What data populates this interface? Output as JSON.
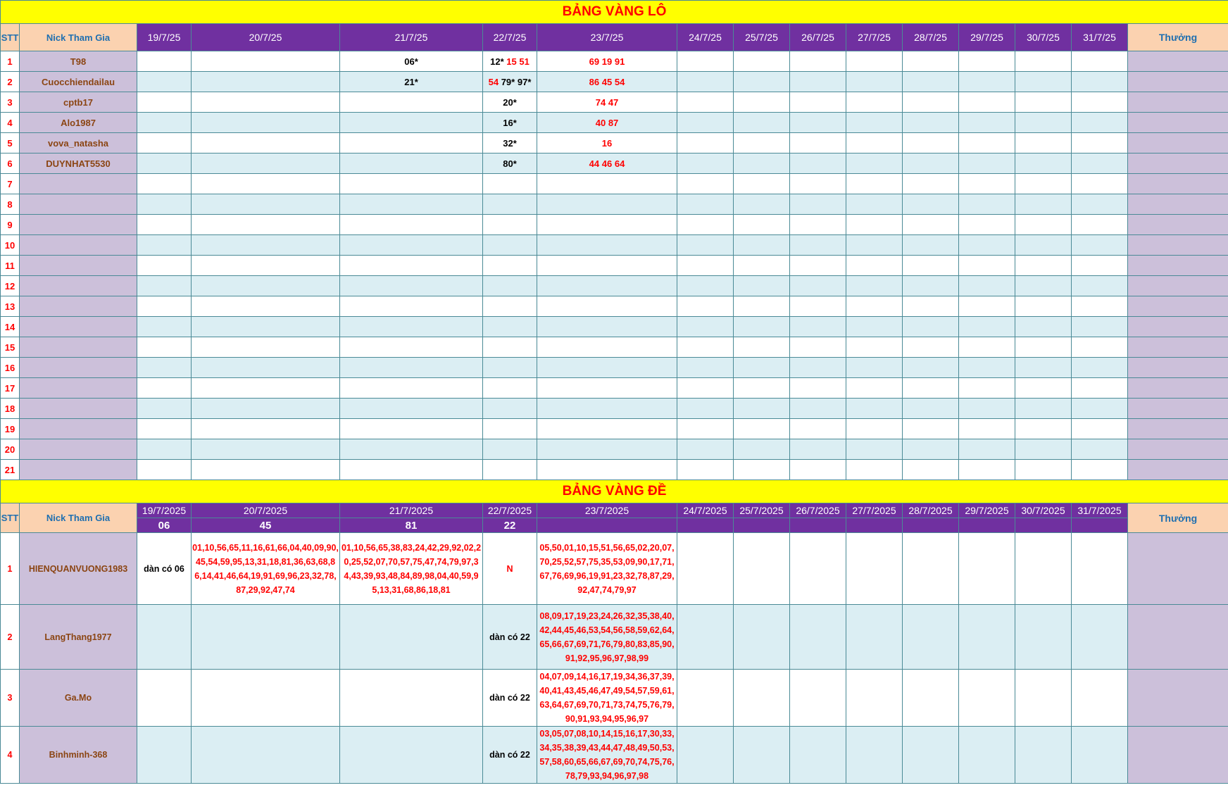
{
  "lo": {
    "title": "BẢNG VÀNG LÔ",
    "headers": {
      "stt": "STT",
      "nick": "Nick Tham Gia",
      "prize": "Thưởng"
    },
    "dates": [
      "19/7/25",
      "20/7/25",
      "21/7/25",
      "22/7/25",
      "23/7/25",
      "24/7/25",
      "25/7/25",
      "26/7/25",
      "27/7/25",
      "28/7/25",
      "29/7/25",
      "30/7/25",
      "31/7/25"
    ],
    "rows": [
      {
        "n": "1",
        "nick": "T98",
        "cells": [
          "",
          "",
          "06*",
          "12* |15 51",
          "69 19 91",
          "",
          "",
          "",
          "",
          "",
          "",
          "",
          ""
        ]
      },
      {
        "n": "2",
        "nick": "Cuocchiendailau",
        "cells": [
          "",
          "",
          "21*",
          "54| 79* 97*",
          "86 45 54",
          "",
          "",
          "",
          "",
          "",
          "",
          "",
          ""
        ]
      },
      {
        "n": "3",
        "nick": "cptb17",
        "cells": [
          "",
          "",
          "",
          "20*",
          "74 47",
          "",
          "",
          "",
          "",
          "",
          "",
          "",
          ""
        ]
      },
      {
        "n": "4",
        "nick": "Alo1987",
        "cells": [
          "",
          "",
          "",
          "16*",
          "40 87",
          "",
          "",
          "",
          "",
          "",
          "",
          "",
          ""
        ]
      },
      {
        "n": "5",
        "nick": "vova_natasha",
        "cells": [
          "",
          "",
          "",
          "32*",
          "16",
          "",
          "",
          "",
          "",
          "",
          "",
          "",
          ""
        ]
      },
      {
        "n": "6",
        "nick": "DUYNHAT5530",
        "cells": [
          "",
          "",
          "",
          "80*",
          "44 46 64",
          "",
          "",
          "",
          "",
          "",
          "",
          "",
          ""
        ]
      },
      {
        "n": "7",
        "nick": "",
        "cells": [
          "",
          "",
          "",
          "",
          "",
          "",
          "",
          "",
          "",
          "",
          "",
          "",
          ""
        ]
      },
      {
        "n": "8",
        "nick": "",
        "cells": [
          "",
          "",
          "",
          "",
          "",
          "",
          "",
          "",
          "",
          "",
          "",
          "",
          ""
        ]
      },
      {
        "n": "9",
        "nick": "",
        "cells": [
          "",
          "",
          "",
          "",
          "",
          "",
          "",
          "",
          "",
          "",
          "",
          "",
          ""
        ]
      },
      {
        "n": "10",
        "nick": "",
        "cells": [
          "",
          "",
          "",
          "",
          "",
          "",
          "",
          "",
          "",
          "",
          "",
          "",
          ""
        ]
      },
      {
        "n": "11",
        "nick": "",
        "cells": [
          "",
          "",
          "",
          "",
          "",
          "",
          "",
          "",
          "",
          "",
          "",
          "",
          ""
        ]
      },
      {
        "n": "12",
        "nick": "",
        "cells": [
          "",
          "",
          "",
          "",
          "",
          "",
          "",
          "",
          "",
          "",
          "",
          "",
          ""
        ]
      },
      {
        "n": "13",
        "nick": "",
        "cells": [
          "",
          "",
          "",
          "",
          "",
          "",
          "",
          "",
          "",
          "",
          "",
          "",
          ""
        ]
      },
      {
        "n": "14",
        "nick": "",
        "cells": [
          "",
          "",
          "",
          "",
          "",
          "",
          "",
          "",
          "",
          "",
          "",
          "",
          ""
        ]
      },
      {
        "n": "15",
        "nick": "",
        "cells": [
          "",
          "",
          "",
          "",
          "",
          "",
          "",
          "",
          "",
          "",
          "",
          "",
          ""
        ]
      },
      {
        "n": "16",
        "nick": "",
        "cells": [
          "",
          "",
          "",
          "",
          "",
          "",
          "",
          "",
          "",
          "",
          "",
          "",
          ""
        ]
      },
      {
        "n": "17",
        "nick": "",
        "cells": [
          "",
          "",
          "",
          "",
          "",
          "",
          "",
          "",
          "",
          "",
          "",
          "",
          ""
        ]
      },
      {
        "n": "18",
        "nick": "",
        "cells": [
          "",
          "",
          "",
          "",
          "",
          "",
          "",
          "",
          "",
          "",
          "",
          "",
          ""
        ]
      },
      {
        "n": "19",
        "nick": "",
        "cells": [
          "",
          "",
          "",
          "",
          "",
          "",
          "",
          "",
          "",
          "",
          "",
          "",
          ""
        ]
      },
      {
        "n": "20",
        "nick": "",
        "cells": [
          "",
          "",
          "",
          "",
          "",
          "",
          "",
          "",
          "",
          "",
          "",
          "",
          ""
        ]
      },
      {
        "n": "21",
        "nick": "",
        "cells": [
          "",
          "",
          "",
          "",
          "",
          "",
          "",
          "",
          "",
          "",
          "",
          "",
          ""
        ]
      }
    ]
  },
  "de": {
    "title": "BẢNG VÀNG ĐỀ",
    "headers": {
      "stt": "STT",
      "nick": "Nick Tham Gia",
      "prize": "Thưởng"
    },
    "dates": [
      "19/7/2025",
      "20/7/2025",
      "21/7/2025",
      "22/7/2025",
      "23/7/2025",
      "24/7/2025",
      "25/7/2025",
      "26/7/2025",
      "27/7/2025",
      "28/7/2025",
      "29/7/2025",
      "30/7/2025",
      "31/7/2025"
    ],
    "results": [
      "06",
      "45",
      "81",
      "22",
      "",
      "",
      "",
      "",
      "",
      "",
      "",
      "",
      ""
    ],
    "rows": [
      {
        "n": "1",
        "nick": "HIENQUANVUONG1983",
        "cells": [
          {
            "text": "dàn có 06",
            "color": "black"
          },
          {
            "text": "01,10,56,65,11,16,61,66,04,40,09,90,45,54,59,95,13,31,18,81,36,63,68,86,14,41,46,64,19,91,69,96,23,32,78,87,29,92,47,74",
            "color": "red"
          },
          {
            "text": "01,10,56,65,38,83,24,42,29,92,02,20,25,52,07,70,57,75,47,74,79,97,34,43,39,93,48,84,89,98,04,40,59,95,13,31,68,86,18,81",
            "color": "red"
          },
          {
            "text": "N",
            "color": "red"
          },
          {
            "text": "05,50,01,10,15,51,56,65,02,20,07,70,25,52,57,75,35,53,09,90,17,71,67,76,69,96,19,91,23,32,78,87,29,92,47,74,79,97",
            "color": "red"
          },
          {
            "text": ""
          },
          {
            "text": ""
          },
          {
            "text": ""
          },
          {
            "text": ""
          },
          {
            "text": ""
          },
          {
            "text": ""
          },
          {
            "text": ""
          },
          {
            "text": ""
          }
        ]
      },
      {
        "n": "2",
        "nick": "LangThang1977",
        "cells": [
          {
            "text": ""
          },
          {
            "text": ""
          },
          {
            "text": ""
          },
          {
            "text": "dàn có 22",
            "color": "black"
          },
          {
            "text": "08,09,17,19,23,24,26,32,35,38,40,42,44,45,46,53,54,56,58,59,62,64,65,66,67,69,71,76,79,80,83,85,90,91,92,95,96,97,98,99",
            "color": "red"
          },
          {
            "text": ""
          },
          {
            "text": ""
          },
          {
            "text": ""
          },
          {
            "text": ""
          },
          {
            "text": ""
          },
          {
            "text": ""
          },
          {
            "text": ""
          },
          {
            "text": ""
          }
        ]
      },
      {
        "n": "3",
        "nick": "Ga.Mo",
        "cells": [
          {
            "text": ""
          },
          {
            "text": ""
          },
          {
            "text": ""
          },
          {
            "text": "dàn có 22",
            "color": "black"
          },
          {
            "text": "04,07,09,14,16,17,19,34,36,37,39,40,41,43,45,46,47,49,54,57,59,61,63,64,67,69,70,71,73,74,75,76,79,90,91,93,94,95,96,97",
            "color": "red"
          },
          {
            "text": ""
          },
          {
            "text": ""
          },
          {
            "text": ""
          },
          {
            "text": ""
          },
          {
            "text": ""
          },
          {
            "text": ""
          },
          {
            "text": ""
          },
          {
            "text": ""
          }
        ]
      },
      {
        "n": "4",
        "nick": "Binhminh-368",
        "cells": [
          {
            "text": ""
          },
          {
            "text": ""
          },
          {
            "text": ""
          },
          {
            "text": "dàn có 22",
            "color": "black"
          },
          {
            "text": "03,05,07,08,10,14,15,16,17,30,33,34,35,38,39,43,44,47,48,49,50,53,57,58,60,65,66,67,69,70,74,75,76,78,79,93,94,96,97,98",
            "color": "red"
          },
          {
            "text": ""
          },
          {
            "text": ""
          },
          {
            "text": ""
          },
          {
            "text": ""
          },
          {
            "text": ""
          },
          {
            "text": ""
          },
          {
            "text": ""
          },
          {
            "text": ""
          }
        ]
      }
    ]
  },
  "colors": {
    "title_bg": "#ffff00",
    "title_text": "#ff0000",
    "header_purple": "#7030a0",
    "header_peach": "#fbd2b0",
    "nick_bg": "#ccc0da",
    "alt_row": "#dbeef3",
    "grid": "#4a8a96"
  }
}
